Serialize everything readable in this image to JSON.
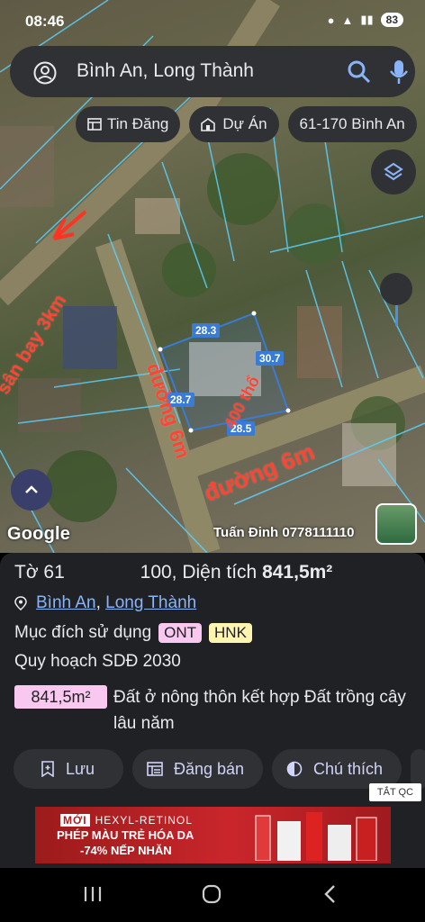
{
  "status": {
    "time": "08:46",
    "battery": "83"
  },
  "search": {
    "query": "Bình An, Long Thành"
  },
  "chips": [
    {
      "icon": "newspaper-icon",
      "label": "Tin Đăng"
    },
    {
      "icon": "building-icon",
      "label": "Dự Án"
    },
    {
      "icon": "",
      "label": "61-170 Bình An"
    }
  ],
  "map": {
    "dimensions": {
      "top": "28.3",
      "right": "30.7",
      "left": "28.7",
      "bottom": "28.5"
    },
    "annotations": {
      "airport": "sân bay 3km",
      "road_left": "đường 6m",
      "road_right": "đường 6m",
      "area": "400 thổ"
    },
    "google": "Google",
    "author": "Tuấn Đinh 0778111110"
  },
  "parcel": {
    "title_prefix": "Tờ 61",
    "title_suffix": "100, Diện tích",
    "area_value": "841,5m²",
    "location": {
      "ward": "Bình An",
      "separator": ",",
      "district": "Long Thành"
    },
    "purpose_label": "Mục đích sử dụng",
    "tags": [
      "ONT",
      "HNK"
    ],
    "planning": "Quy hoạch SDĐ 2030",
    "area_badge": "841,5m²",
    "area_description": "Đất ở nông thôn kết hợp Đất trồng cây lâu năm"
  },
  "actions": [
    {
      "icon": "bookmark-add-icon",
      "label": "Lưu"
    },
    {
      "icon": "list-post-icon",
      "label": "Đăng bán"
    },
    {
      "icon": "contrast-icon",
      "label": "Chú thích"
    }
  ],
  "ad": {
    "close_label": "TẮT QC",
    "brand_prefix": "MỚI",
    "product": "HEXYL-RETINOL",
    "line2": "PHÉP MÀU TRẺ HÓA DA",
    "line3": "-74% NẾP NHĂN"
  },
  "colors": {
    "accent": "#8ab4f8",
    "parcel_outline": "#3a7bd5",
    "annotation": "#ff4433"
  }
}
